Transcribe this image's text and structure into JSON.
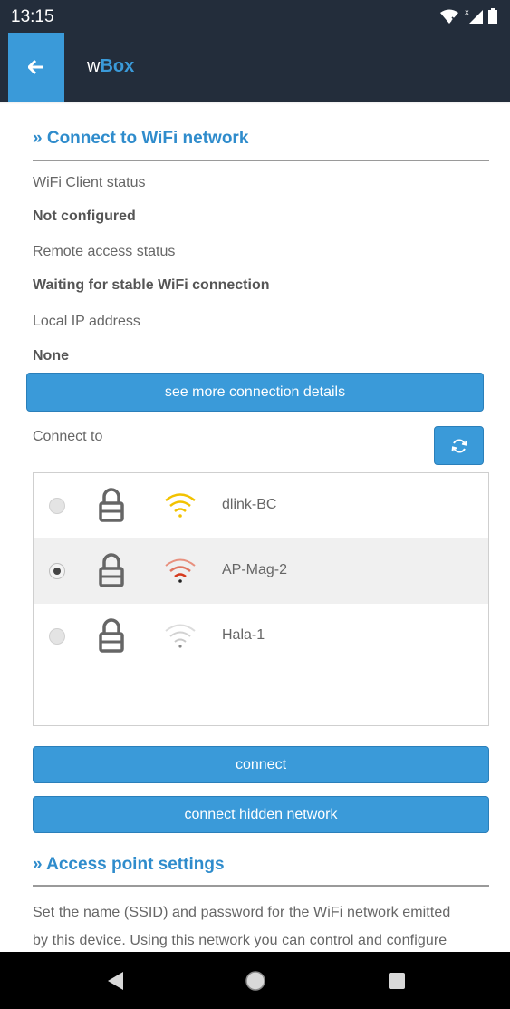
{
  "status_bar": {
    "time": "13:15"
  },
  "app_bar": {
    "title_prefix": "w",
    "title_accent": "Box"
  },
  "wifi_section": {
    "title": "» Connect to WiFi network",
    "client_status_label": "WiFi Client status",
    "client_status_value": "Not configured",
    "remote_status_label": "Remote access status",
    "remote_status_value": "Waiting for stable WiFi connection",
    "ip_label": "Local IP address",
    "ip_value": "None",
    "details_button": "see more connection details",
    "connect_to_label": "Connect to",
    "networks": [
      {
        "ssid": "dlink-BC",
        "selected": false,
        "signal_color": "#f2c200"
      },
      {
        "ssid": "AP-Mag-2",
        "selected": true,
        "signal_color": "#d63a1e"
      },
      {
        "ssid": "Hala-1",
        "selected": false,
        "signal_color": "#c8c8c8"
      }
    ],
    "connect_button": "connect",
    "connect_hidden_button": "connect hidden network"
  },
  "ap_section": {
    "title": "» Access point settings",
    "description_line1": "Set the name (SSID) and password for the WiFi network emitted",
    "description_line2": "by this device. Using this network you can control and configure"
  },
  "colors": {
    "accent": "#3a9ad9",
    "header_bg": "#232d3b"
  }
}
